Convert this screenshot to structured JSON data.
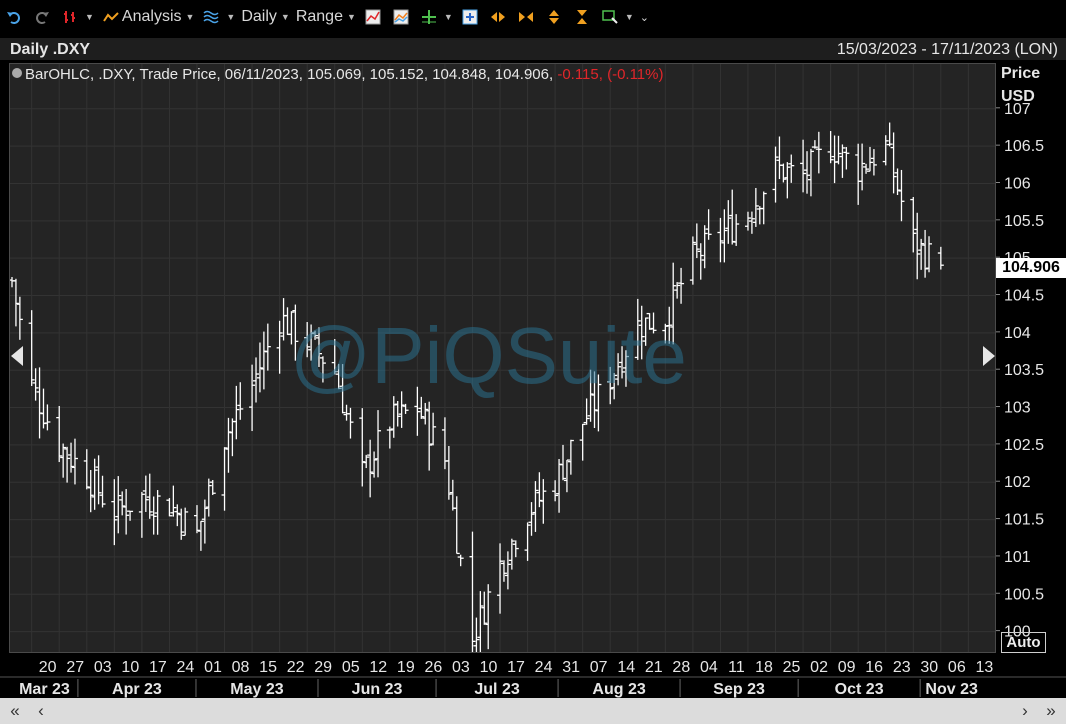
{
  "toolbar": {
    "analysis_label": "Analysis",
    "interval_label": "Daily",
    "range_label": "Range"
  },
  "header": {
    "title": "Daily .DXY",
    "date_range": "15/03/2023 - 17/11/2023 (LON)"
  },
  "legend": {
    "text": "BarOHLC, .DXY, Trade Price, 06/11/2023, 105.069, 105.152, 104.848, 104.906,",
    "change": "-0.115, (-0.11%)"
  },
  "y_axis": {
    "title": "Price",
    "unit": "USD"
  },
  "last_price": "104.906",
  "auto_label": "Auto",
  "watermark": "@PiQSuite",
  "colors": {
    "background": "#242424",
    "bars": "#ffffff",
    "negative": "#e0262a",
    "watermark": "#2a6f8d"
  },
  "chart_data": {
    "type": "bar",
    "subtype": "ohlc",
    "ylim": [
      99.7,
      107.6
    ],
    "y_ticks": [
      100,
      100.5,
      101,
      101.5,
      102,
      102.5,
      103,
      103.5,
      104,
      104.5,
      105,
      105.5,
      106,
      106.5,
      107
    ],
    "y_tick_labels": [
      "100",
      "100.5",
      "101",
      "101.5",
      "102",
      "102.5",
      "103",
      "103.5",
      "104",
      "104.5",
      "105",
      "105.5",
      "106",
      "106.5",
      "107"
    ],
    "x_ticks": [
      {
        "label": "20",
        "date": "2023-03-20"
      },
      {
        "label": "27",
        "date": "2023-03-27"
      },
      {
        "label": "03",
        "date": "2023-04-03"
      },
      {
        "label": "10",
        "date": "2023-04-10"
      },
      {
        "label": "17",
        "date": "2023-04-17"
      },
      {
        "label": "24",
        "date": "2023-04-24"
      },
      {
        "label": "01",
        "date": "2023-05-01"
      },
      {
        "label": "08",
        "date": "2023-05-08"
      },
      {
        "label": "15",
        "date": "2023-05-15"
      },
      {
        "label": "22",
        "date": "2023-05-22"
      },
      {
        "label": "29",
        "date": "2023-05-29"
      },
      {
        "label": "05",
        "date": "2023-06-05"
      },
      {
        "label": "12",
        "date": "2023-06-12"
      },
      {
        "label": "19",
        "date": "2023-06-19"
      },
      {
        "label": "26",
        "date": "2023-06-26"
      },
      {
        "label": "03",
        "date": "2023-07-03"
      },
      {
        "label": "10",
        "date": "2023-07-10"
      },
      {
        "label": "17",
        "date": "2023-07-17"
      },
      {
        "label": "24",
        "date": "2023-07-24"
      },
      {
        "label": "31",
        "date": "2023-07-31"
      },
      {
        "label": "07",
        "date": "2023-08-07"
      },
      {
        "label": "14",
        "date": "2023-08-14"
      },
      {
        "label": "21",
        "date": "2023-08-21"
      },
      {
        "label": "28",
        "date": "2023-08-28"
      },
      {
        "label": "04",
        "date": "2023-09-04"
      },
      {
        "label": "11",
        "date": "2023-09-11"
      },
      {
        "label": "18",
        "date": "2023-09-18"
      },
      {
        "label": "25",
        "date": "2023-09-25"
      },
      {
        "label": "02",
        "date": "2023-10-02"
      },
      {
        "label": "09",
        "date": "2023-10-09"
      },
      {
        "label": "16",
        "date": "2023-10-16"
      },
      {
        "label": "23",
        "date": "2023-10-23"
      },
      {
        "label": "30",
        "date": "2023-10-30"
      },
      {
        "label": "06",
        "date": "2023-11-06"
      },
      {
        "label": "13",
        "date": "2023-11-13"
      }
    ],
    "months": [
      {
        "label": "Mar 23",
        "start": "2023-03-15"
      },
      {
        "label": "Apr 23",
        "start": "2023-04-01"
      },
      {
        "label": "May 23",
        "start": "2023-05-01"
      },
      {
        "label": "Jun 23",
        "start": "2023-06-01"
      },
      {
        "label": "Jul 23",
        "start": "2023-07-01"
      },
      {
        "label": "Aug 23",
        "start": "2023-08-01"
      },
      {
        "label": "Sep 23",
        "start": "2023-09-01"
      },
      {
        "label": "Oct 23",
        "start": "2023-10-01"
      },
      {
        "label": "Nov 23",
        "start": "2023-11-01"
      }
    ],
    "range_end": "2023-11-17",
    "weekly_closes": [
      {
        "date": "2023-03-15",
        "close": 104.7
      },
      {
        "date": "2023-03-20",
        "close": 103.3
      },
      {
        "date": "2023-03-27",
        "close": 102.5
      },
      {
        "date": "2023-04-03",
        "close": 102.1
      },
      {
        "date": "2023-04-10",
        "close": 101.6
      },
      {
        "date": "2023-04-17",
        "close": 101.8
      },
      {
        "date": "2023-04-24",
        "close": 101.7
      },
      {
        "date": "2023-05-01",
        "close": 101.3
      },
      {
        "date": "2023-05-08",
        "close": 102.6
      },
      {
        "date": "2023-05-15",
        "close": 103.3
      },
      {
        "date": "2023-05-22",
        "close": 104.2
      },
      {
        "date": "2023-05-29",
        "close": 103.9
      },
      {
        "date": "2023-06-05",
        "close": 103.5
      },
      {
        "date": "2023-06-12",
        "close": 102.1
      },
      {
        "date": "2023-06-19",
        "close": 102.8
      },
      {
        "date": "2023-06-26",
        "close": 103.0
      },
      {
        "date": "2023-07-03",
        "close": 102.3
      },
      {
        "date": "2023-07-10",
        "close": 99.9
      },
      {
        "date": "2023-07-17",
        "close": 100.9
      },
      {
        "date": "2023-07-24",
        "close": 101.6
      },
      {
        "date": "2023-07-31",
        "close": 102.0
      },
      {
        "date": "2023-08-07",
        "close": 102.8
      },
      {
        "date": "2023-08-14",
        "close": 103.4
      },
      {
        "date": "2023-08-21",
        "close": 104.1
      },
      {
        "date": "2023-08-28",
        "close": 104.2
      },
      {
        "date": "2023-09-04",
        "close": 105.0
      },
      {
        "date": "2023-09-11",
        "close": 105.3
      },
      {
        "date": "2023-09-18",
        "close": 105.6
      },
      {
        "date": "2023-09-25",
        "close": 106.2
      },
      {
        "date": "2023-10-02",
        "close": 106.1
      },
      {
        "date": "2023-10-09",
        "close": 106.5
      },
      {
        "date": "2023-10-16",
        "close": 106.2
      },
      {
        "date": "2023-10-23",
        "close": 106.5
      },
      {
        "date": "2023-10-30",
        "close": 105.2
      },
      {
        "date": "2023-11-06",
        "close": 104.9
      }
    ],
    "bars_summary": {
      "last_date": "2023-11-06",
      "open": 105.069,
      "high": 105.152,
      "low": 104.848,
      "close": 104.906
    }
  }
}
